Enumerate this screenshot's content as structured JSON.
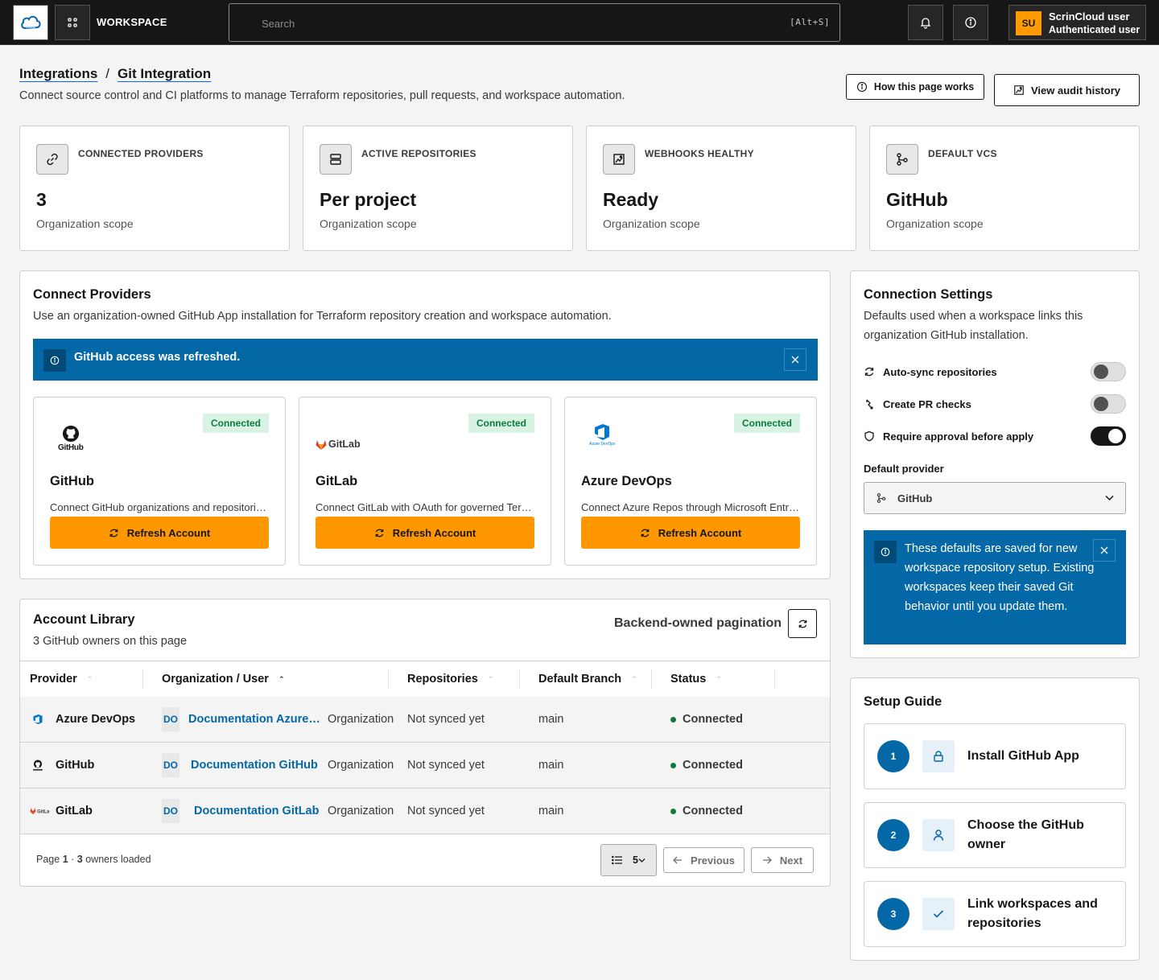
{
  "header": {
    "workspace_label": "WORKSPACE",
    "search_placeholder": "Search",
    "search_shortcut": "[Alt+S]",
    "user_initials": "SU",
    "user_name": "ScrinCloud user",
    "user_role": "Authenticated user"
  },
  "page": {
    "breadcrumb_parent": "Integrations",
    "breadcrumb_sep": "/",
    "breadcrumb_current": "Git Integration",
    "subtitle": "Connect source control and CI platforms to manage Terraform repositories, pull requests, and workspace automation.",
    "how_button": "How this page works",
    "audit_button": "View audit history"
  },
  "stats": [
    {
      "label": "CONNECTED PROVIDERS",
      "value": "3",
      "scope": "Organization scope",
      "icon": "link-icon"
    },
    {
      "label": "ACTIVE REPOSITORIES",
      "value": "Per project",
      "scope": "Organization scope",
      "icon": "storage-icon"
    },
    {
      "label": "WEBHOOKS HEALTHY",
      "value": "Ready",
      "scope": "Organization scope",
      "icon": "image-icon"
    },
    {
      "label": "DEFAULT VCS",
      "value": "GitHub",
      "scope": "Organization scope",
      "icon": "branch-icon"
    }
  ],
  "connect": {
    "title": "Connect Providers",
    "description": "Use an organization-owned GitHub App installation for Terraform repository creation and workspace automation.",
    "banner": "GitHub access was refreshed.",
    "providers": [
      {
        "name": "GitHub",
        "status": "Connected",
        "description": "Connect GitHub organizations and repositories through the GitHub App.",
        "button": "Refresh Account",
        "logo_text": "GitHub"
      },
      {
        "name": "GitLab",
        "status": "Connected",
        "description": "Connect GitLab with OAuth for governed Terraform repositories.",
        "button": "Refresh Account",
        "logo_text": "GitLab"
      },
      {
        "name": "Azure DevOps",
        "status": "Connected",
        "description": "Connect Azure Repos through Microsoft Entra ID.",
        "button": "Refresh Account",
        "logo_text": "Azure DevOps"
      }
    ]
  },
  "library": {
    "title": "Account Library",
    "subtitle": "3 GitHub owners on this page",
    "pagination_label": "Backend-owned pagination",
    "columns": [
      "Provider",
      "Organization / User",
      "Repositories",
      "Default Branch",
      "Status"
    ],
    "rows": [
      {
        "provider": "Azure DevOps",
        "initials": "DO",
        "org": "Documentation Azure DevOps",
        "type": "Organization",
        "repos": "Not synced yet",
        "branch": "main",
        "status": "Connected"
      },
      {
        "provider": "GitHub",
        "initials": "DO",
        "org": "Documentation GitHub",
        "type": "Organization",
        "repos": "Not synced yet",
        "branch": "main",
        "status": "Connected"
      },
      {
        "provider": "GitLab",
        "initials": "DO",
        "org": "Documentation GitLab",
        "type": "Organization",
        "repos": "Not synced yet",
        "branch": "main",
        "status": "Connected"
      }
    ],
    "footer_page_label": "Page",
    "footer_page": "1",
    "footer_sep": "·",
    "footer_count": "3",
    "footer_loaded": "owners loaded",
    "page_size": "5",
    "prev": "Previous",
    "next": "Next"
  },
  "settings": {
    "title": "Connection Settings",
    "description": "Defaults used when a workspace links this organization GitHub installation.",
    "toggles": [
      {
        "label": "Auto-sync repositories",
        "on": false,
        "icon": "sync-icon"
      },
      {
        "label": "Create PR checks",
        "on": false,
        "icon": "pull-request-icon"
      },
      {
        "label": "Require approval before apply",
        "on": true,
        "icon": "shield-icon"
      }
    ],
    "default_provider_label": "Default provider",
    "default_provider": "GitHub",
    "banner": "These defaults are saved for new workspace repository setup. Existing workspaces keep their saved Git behavior until you update them."
  },
  "guide": {
    "title": "Setup Guide",
    "steps": [
      {
        "num": "1",
        "label": "Install GitHub App",
        "icon": "lock-icon"
      },
      {
        "num": "2",
        "label": "Choose the GitHub owner",
        "icon": "user-icon"
      },
      {
        "num": "3",
        "label": "Link workspaces and repositories",
        "icon": "checkmark-icon"
      }
    ]
  },
  "colors": {
    "accent_orange": "#ff9800",
    "banner_blue": "#0568a6",
    "connected_green": "#0e7a3b",
    "topbar": "#161616"
  }
}
